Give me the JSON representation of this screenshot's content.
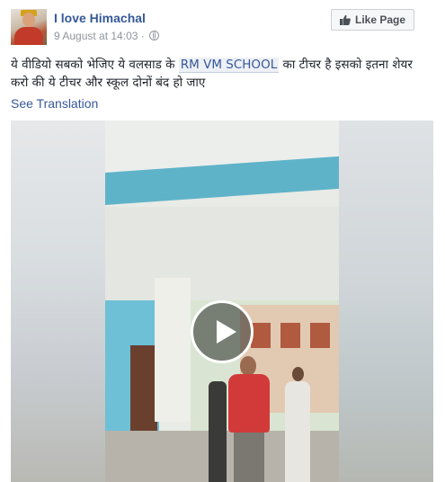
{
  "post": {
    "page_name": "I love Himachal",
    "date": "9 August at 14:03",
    "separator": "·",
    "like_button_label": "Like Page",
    "caption_before": "ये वीडियो सबको भेजिए ये वलसाड के ",
    "caption_mention": "RM VM SCHOOL",
    "caption_after": " का टीचर है इसको इतना शेयर करो की ये टीचर और स्कूल दोनों बंद हो जाए",
    "see_translation": "See Translation"
  },
  "icons": {
    "like_button": "thumbs-up-icon",
    "audience": "globe-icon",
    "video": "play-icon"
  },
  "colors": {
    "link": "#365899",
    "meta": "#90949c",
    "button_bg": "#f6f7f9"
  }
}
